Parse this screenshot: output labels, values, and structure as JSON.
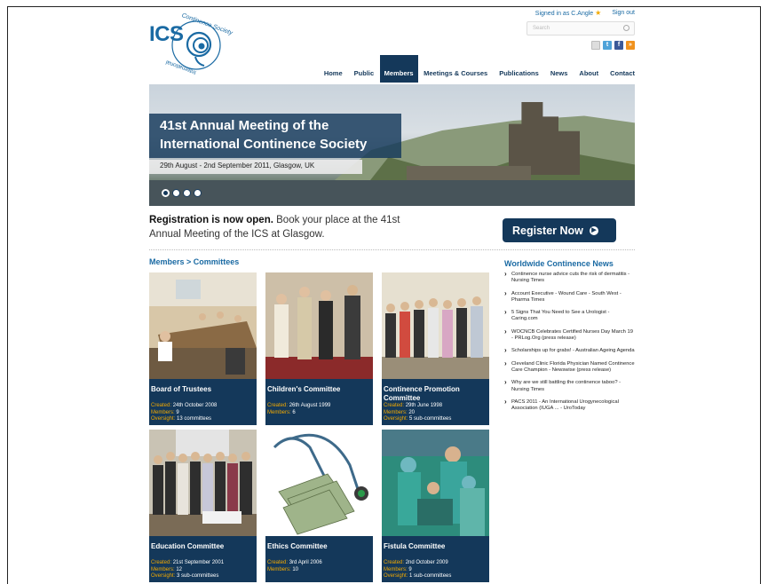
{
  "logo": {
    "text": "ICS",
    "arc_top": "Continence Society",
    "arc_bottom": "International"
  },
  "topbar": {
    "signed_in": "Signed in as C.Angle",
    "sign_out": "Sign out"
  },
  "search": {
    "placeholder": "Search"
  },
  "social": [
    "email-icon",
    "twitter-icon",
    "facebook-icon",
    "rss-icon"
  ],
  "nav": [
    {
      "label": "Home",
      "active": false
    },
    {
      "label": "Public",
      "active": false
    },
    {
      "label": "Members",
      "active": true
    },
    {
      "label": "Meetings & Courses",
      "active": false
    },
    {
      "label": "Publications",
      "active": false
    },
    {
      "label": "News",
      "active": false
    },
    {
      "label": "About",
      "active": false
    },
    {
      "label": "Contact",
      "active": false
    }
  ],
  "banner": {
    "title_line1": "41st Annual Meeting of the",
    "title_line2": "International Continence Society",
    "subtitle": "29th August - 2nd September 2011, Glasgow, UK",
    "dots": 4,
    "active_dot": 0
  },
  "registration": {
    "bold": "Registration is now open.",
    "text": " Book your place at the 41st Annual Meeting of the ICS at Glasgow.",
    "button": "Register Now"
  },
  "breadcrumb": "Members > Committees",
  "committees": [
    {
      "name": "Board of Trustees",
      "created": "24th October 2008",
      "members": "9",
      "oversight": "13 committees"
    },
    {
      "name": "Children's Committee",
      "created": "26th August 1999",
      "members": "6",
      "oversight": ""
    },
    {
      "name": "Continence Promotion Committee",
      "created": "29th June 1998",
      "members": "20",
      "oversight": "5 sub-committees"
    },
    {
      "name": "Education Committee",
      "created": "21st September 2001",
      "members": "12",
      "oversight": "3 sub-committees"
    },
    {
      "name": "Ethics Committee",
      "created": "3rd April 2006",
      "members": "10",
      "oversight": ""
    },
    {
      "name": "Fistula Committee",
      "created": "2nd October 2009",
      "members": "9",
      "oversight": "1 sub-committees"
    }
  ],
  "meta_labels": {
    "created": "Created:",
    "members": "Members:",
    "oversight": "Oversight:"
  },
  "news": {
    "title": "Worldwide Continence News",
    "items": [
      "Continence nurse advice cuts the risk of dermatitis - Nursing Times",
      "Account Executive - Wound Care - South West - Pharma Times",
      "5 Signs That You Need to See a Urologist - Caring.com",
      "WOCNCB Celebrates Certified Nurses Day March 19 - PRLog.Org (press release)",
      "Scholarships up for grabs! - Australian Ageing Agenda",
      "Cleveland Clinic Florida Physician Named Continence Care Champion - Newswise (press release)",
      "Why are we still battling the continence taboo? - Nursing Times",
      "PACS 2011 - An International Urogynecological Association (IUGA ... - UroToday"
    ]
  },
  "colors": {
    "navy": "#14385a",
    "blue": "#1a6aa3",
    "orange": "#f2a900"
  }
}
